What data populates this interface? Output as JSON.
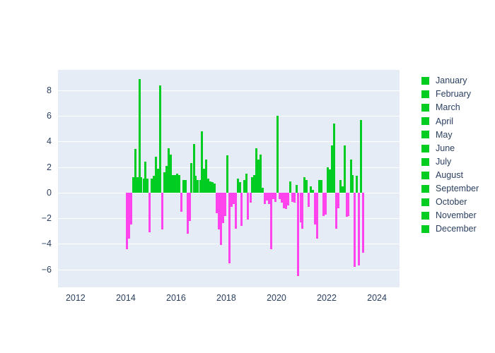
{
  "chart_data": {
    "type": "bar",
    "title": "",
    "subtitle": "",
    "xlabel": "",
    "ylabel": "",
    "xlim": [
      2011.3,
      2024.9
    ],
    "ylim": [
      -7.4,
      9.6
    ],
    "grid": true,
    "legend_position": "right",
    "xticks": [
      "2012",
      "2014",
      "2016",
      "2018",
      "2020",
      "2022",
      "2024"
    ],
    "xtick_values": [
      2012,
      2014,
      2016,
      2018,
      2020,
      2022,
      2024
    ],
    "yticks": [
      "8",
      "6",
      "4",
      "2",
      "0",
      "−2",
      "−4",
      "−6"
    ],
    "ytick_values": [
      8,
      6,
      4,
      2,
      0,
      -2,
      -4,
      -6
    ],
    "colors": {
      "positive": "#00cc22",
      "negative": "#ff44ee",
      "plot_background": "#e5ecf6",
      "gridline": "#ffffff",
      "paper_background": "#ffffff",
      "tick_text": "#2a3f5f"
    },
    "series": [
      {
        "name": "January",
        "color": "#00cc22"
      },
      {
        "name": "February",
        "color": "#00cc22"
      },
      {
        "name": "March",
        "color": "#00cc22"
      },
      {
        "name": "April",
        "color": "#00cc22"
      },
      {
        "name": "May",
        "color": "#00cc22"
      },
      {
        "name": "June",
        "color": "#00cc22"
      },
      {
        "name": "July",
        "color": "#00cc22"
      },
      {
        "name": "August",
        "color": "#00cc22"
      },
      {
        "name": "September",
        "color": "#00cc22"
      },
      {
        "name": "October",
        "color": "#00cc22"
      },
      {
        "name": "November",
        "color": "#00cc22"
      },
      {
        "name": "December",
        "color": "#00cc22"
      }
    ],
    "x": [
      2014.04,
      2014.12,
      2014.21,
      2014.29,
      2014.37,
      2014.46,
      2014.54,
      2014.62,
      2014.71,
      2014.79,
      2014.87,
      2014.96,
      2015.04,
      2015.12,
      2015.21,
      2015.29,
      2015.37,
      2015.46,
      2015.54,
      2015.62,
      2015.71,
      2015.79,
      2015.87,
      2015.96,
      2016.04,
      2016.12,
      2016.21,
      2016.29,
      2016.37,
      2016.46,
      2016.54,
      2016.62,
      2016.71,
      2016.79,
      2016.87,
      2016.96,
      2017.04,
      2017.12,
      2017.21,
      2017.29,
      2017.37,
      2017.46,
      2017.54,
      2017.62,
      2017.71,
      2017.79,
      2017.87,
      2017.96,
      2018.04,
      2018.12,
      2018.21,
      2018.29,
      2018.37,
      2018.46,
      2018.54,
      2018.62,
      2018.71,
      2018.79,
      2018.87,
      2018.96,
      2019.04,
      2019.12,
      2019.21,
      2019.29,
      2019.37,
      2019.46,
      2019.54,
      2019.62,
      2019.71,
      2019.79,
      2019.87,
      2019.96,
      2020.04,
      2020.12,
      2020.21,
      2020.29,
      2020.37,
      2020.46,
      2020.54,
      2020.62,
      2020.71,
      2020.79,
      2020.87,
      2020.96,
      2021.04,
      2021.12,
      2021.21,
      2021.29,
      2021.37,
      2021.46,
      2021.54,
      2021.62,
      2021.71,
      2021.79,
      2021.87,
      2021.96,
      2022.04,
      2022.12,
      2022.21,
      2022.29,
      2022.37,
      2022.46,
      2022.54,
      2022.62,
      2022.71,
      2022.79,
      2022.87,
      2022.96,
      2023.04,
      2023.12,
      2023.21,
      2023.29,
      2023.37,
      2023.46
    ],
    "values": [
      -4.4,
      -3.6,
      -2.5,
      1.2,
      3.4,
      1.2,
      8.9,
      1.2,
      1.1,
      2.4,
      1.1,
      -3.1,
      1.1,
      1.3,
      2.8,
      1.9,
      8.4,
      -2.9,
      1.6,
      2.1,
      3.5,
      3.0,
      1.4,
      1.4,
      1.5,
      1.4,
      -1.5,
      1.0,
      1.0,
      -3.2,
      -2.2,
      2.3,
      3.8,
      1.3,
      1.0,
      1.0,
      4.8,
      1.9,
      2.6,
      1.1,
      0.9,
      0.8,
      0.7,
      -1.6,
      -2.9,
      -4.1,
      -2.4,
      -1.8,
      2.9,
      -5.5,
      -1.1,
      -0.9,
      -2.8,
      1.1,
      0.8,
      -2.6,
      1.0,
      1.5,
      -2.1,
      -0.8,
      1.2,
      1.4,
      3.5,
      2.6,
      3.0,
      0.4,
      -0.9,
      -0.6,
      -0.9,
      -4.4,
      -0.5,
      -0.7,
      6.0,
      -0.5,
      -0.8,
      -1.2,
      -1.3,
      -1.0,
      0.9,
      -0.7,
      -0.8,
      0.6,
      -6.5,
      -2.3,
      -2.8,
      1.2,
      1.0,
      -1.1,
      0.5,
      0.2,
      -2.5,
      -3.6,
      1.0,
      1.0,
      -1.8,
      -1.7,
      2.0,
      1.8,
      3.7,
      5.4,
      -2.8,
      -1.2,
      1.0,
      0.5,
      3.7,
      -1.9,
      -1.8,
      2.6,
      1.4,
      -5.8,
      1.3,
      -5.7,
      5.7,
      -4.7
    ]
  },
  "legend": {
    "items": [
      {
        "label": "January"
      },
      {
        "label": "February"
      },
      {
        "label": "March"
      },
      {
        "label": "April"
      },
      {
        "label": "May"
      },
      {
        "label": "June"
      },
      {
        "label": "July"
      },
      {
        "label": "August"
      },
      {
        "label": "September"
      },
      {
        "label": "October"
      },
      {
        "label": "November"
      },
      {
        "label": "December"
      }
    ]
  }
}
